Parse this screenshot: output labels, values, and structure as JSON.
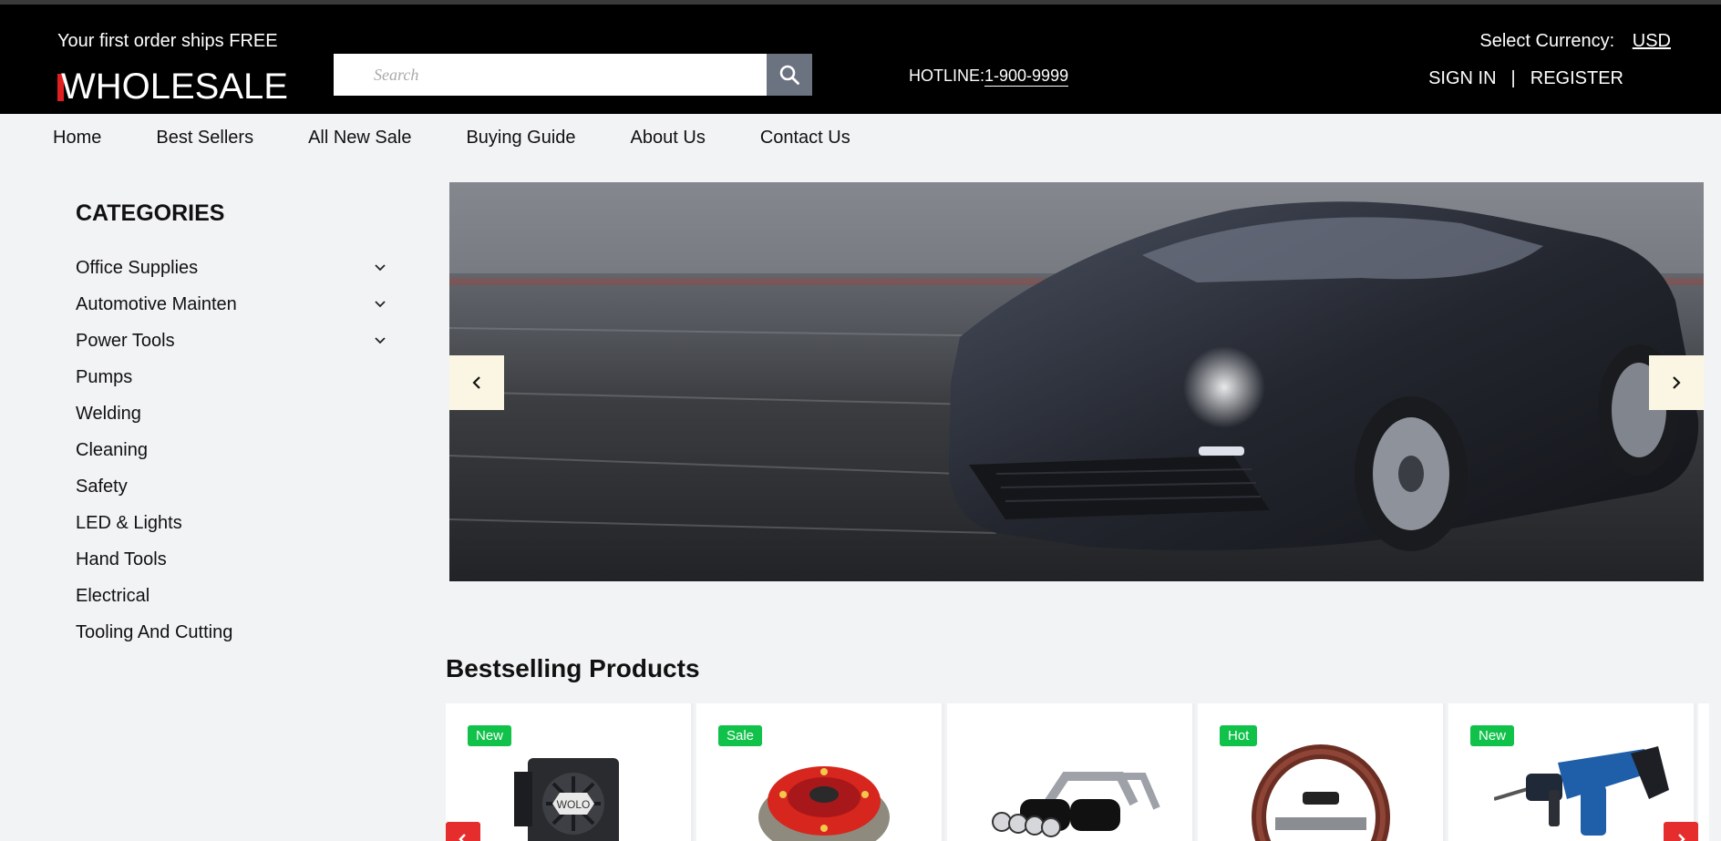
{
  "header": {
    "promo": "Your first order ships FREE",
    "logo_text": "WHOLESALE",
    "search_placeholder": "Search",
    "hotline_label": "HOTLINE:",
    "hotline_number": "1-900-9999",
    "currency_label": "Select Currency:",
    "currency_value": "USD",
    "sign_in": "SIGN IN",
    "separator": "|",
    "register": "REGISTER"
  },
  "nav": [
    "Home",
    "Best Sellers",
    "All New Sale",
    "Buying Guide",
    "About Us",
    "Contact Us"
  ],
  "categories": {
    "title": "CATEGORIES",
    "items": [
      {
        "label": "Office Supplies",
        "expandable": true
      },
      {
        "label": "Automotive Mainten",
        "expandable": true
      },
      {
        "label": "Power Tools",
        "expandable": true
      },
      {
        "label": "Pumps",
        "expandable": false
      },
      {
        "label": "Welding",
        "expandable": false
      },
      {
        "label": "Cleaning",
        "expandable": false
      },
      {
        "label": "Safety",
        "expandable": false
      },
      {
        "label": "LED & Lights",
        "expandable": false
      },
      {
        "label": "Hand Tools",
        "expandable": false
      },
      {
        "label": "Electrical",
        "expandable": false
      },
      {
        "label": "Tooling And Cutting",
        "expandable": false
      }
    ]
  },
  "banner": {
    "image": "sports-car-banner"
  },
  "bestselling": {
    "title": "Bestselling Products",
    "products": [
      {
        "badge": "New",
        "image": "backup-alarm-icon"
      },
      {
        "badge": "Sale",
        "image": "clutch-kit-icon"
      },
      {
        "badge": "",
        "image": "exhaust-system-icon"
      },
      {
        "badge": "Hot",
        "image": "steering-wheel-icon"
      },
      {
        "badge": "New",
        "image": "hammer-drill-icon"
      }
    ]
  },
  "colors": {
    "header_bg": "#000000",
    "page_bg": "#f2f3f5",
    "badge_green": "#11c24a",
    "accent_red": "#e52d2d",
    "search_button": "#6b7280"
  }
}
